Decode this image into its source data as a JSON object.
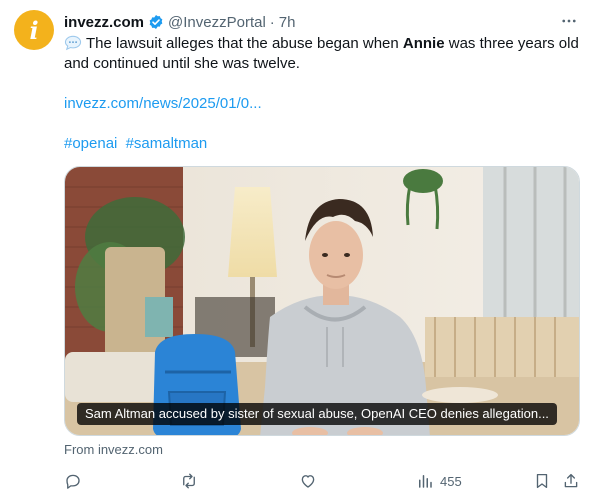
{
  "author": {
    "avatar_glyph": "i",
    "display_name": "invezz.com",
    "handle": "@InvezzPortal",
    "separator": "·",
    "time": "7h",
    "verified": true
  },
  "tweet": {
    "text_before": "The lawsuit alleges that the abuse began when ",
    "text_bold": "Annie",
    "text_after": " was three years old and continued until she was twelve.",
    "link": "invezz.com/news/2025/01/0...",
    "hashtags": [
      "#openai",
      "#samaltman"
    ]
  },
  "card": {
    "caption": "Sam Altman accused by sister of sexual abuse, OpenAI CEO denies allegation...",
    "from": "From invezz.com"
  },
  "actions": {
    "views_count": "455"
  },
  "colors": {
    "link": "#1d9bf0",
    "muted": "#536471",
    "avatar": "#f3b21c"
  }
}
